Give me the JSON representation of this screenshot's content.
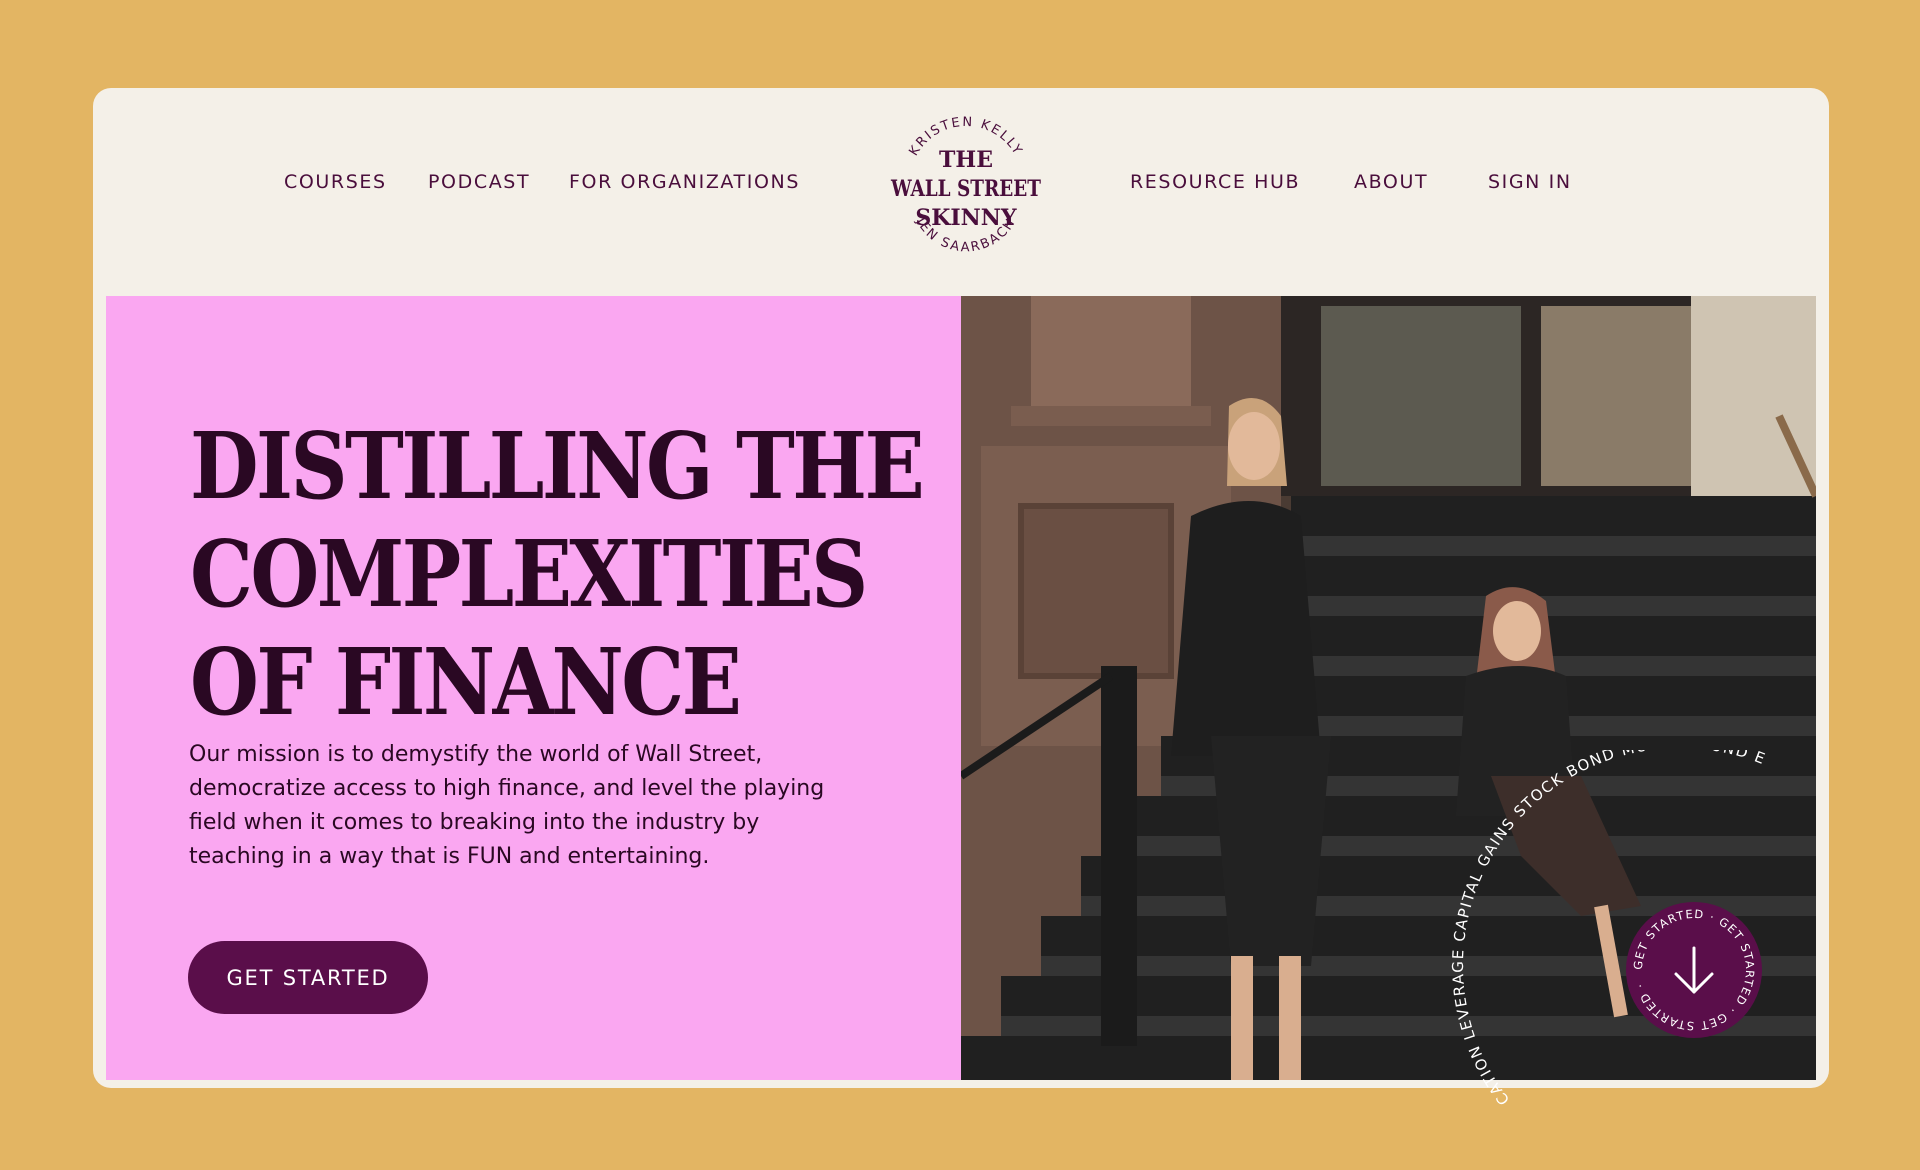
{
  "nav": {
    "left": [
      "COURSES",
      "PODCAST",
      "FOR ORGANIZATIONS"
    ],
    "right": [
      "RESOURCE HUB",
      "ABOUT",
      "SIGN IN"
    ]
  },
  "logo": {
    "top_arc": "KRISTEN KELLY",
    "line1": "THE",
    "line2": "WALL STREET",
    "line3": "SKINNY",
    "bottom_arc": "JEN SAARBACH"
  },
  "hero": {
    "headline": [
      "DISTILLING THE",
      "COMPLEXITIES",
      "OF FINANCE"
    ],
    "mission": "Our mission is to demystify the world of Wall Street, democratize access to high finance, and level the playing field when it comes to breaking into the industry by teaching in a way that is FUN and entertaining.",
    "cta_label": "GET STARTED"
  },
  "ring_words": "CATION LEVERAGE CAPITAL GAINS STOCK BOND MUTUAL FUND E",
  "badge": {
    "ring_text": "GET STARTED · GET STARTED · GET STARTED ·",
    "icon": "arrow-down-icon"
  },
  "colors": {
    "page_bg": "#E3B563",
    "header_bg": "#F4F0E8",
    "hero_pink": "#FAA7F1",
    "brand_plum": "#5A0E4A",
    "text_dark": "#2A0823"
  }
}
